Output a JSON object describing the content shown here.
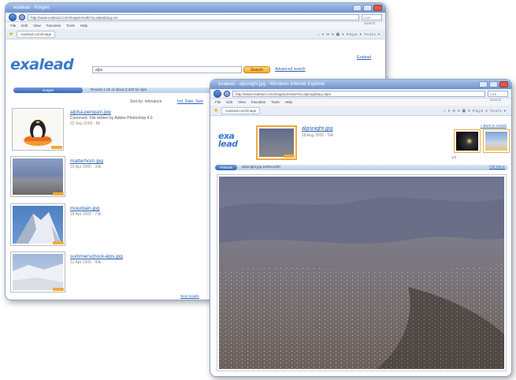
{
  "back_window": {
    "title": "exalead - Images",
    "url": "http://www.exalead.com/image/results?q=alps&lang=en",
    "menus": [
      "File",
      "Edit",
      "View",
      "Favorites",
      "Tools",
      "Help"
    ],
    "tab_label": "exalead.com/image",
    "toolbar_icons": "⌂ ▾ ✉ ▾ 🖶 ▾ Page ▾ Tools ▾",
    "logo": "exalead",
    "search_value": "alps",
    "search_button": "Search",
    "advanced_link": "Advanced search",
    "exalead_link": "Exalead",
    "results_tab": "Images",
    "results_info": "Results 1-20 of about 2,340 for alps",
    "sort_label": "Sort by: relevance",
    "sort_link": "Ind. Date, Size",
    "results": [
      {
        "title": "alpha-penguin.jpg",
        "desc": "Comment: File written by Adobe Photoshop 4.0",
        "meta": "22 Sep 2005 - 8k"
      },
      {
        "title": "matterhorn.jpg",
        "meta": "15 Apr 2005 - 34k"
      },
      {
        "title": "mountain.jpg",
        "meta": "18 Apr 2005 - 73k"
      },
      {
        "title": "summerschool-alps.jpg",
        "meta": "12 Apr 2005 - 49k"
      }
    ],
    "footer_link": "Next results"
  },
  "front_window": {
    "title": "exalead - alpsnight.jpg - Windows Internet Explorer",
    "url": "http://www.exalead.com/image/preview?id=alpsnight&q=alps",
    "menus": [
      "File",
      "Edit",
      "View",
      "Favorites",
      "Tools",
      "Help"
    ],
    "tab_label": "exalead.com/image",
    "toolbar_icons": "⌂ ▾ ✉ ▾ 🖶 ▾ Page ▾ Tools ▾",
    "logo_line1": "exa",
    "logo_line2": "lead",
    "image_title": "alpsnight.jpg",
    "image_meta": "18 Aug 2005 - 54k",
    "back_link": "« Back to results",
    "results_tab": "Preview",
    "preview_info": "alpsnight.jpg 1600x1200",
    "full_size_link": "Full size ▸"
  },
  "colors": {
    "accent_blue": "#3a78c9",
    "title_bar": "#6d92cf",
    "orange": "#f2a93b"
  }
}
